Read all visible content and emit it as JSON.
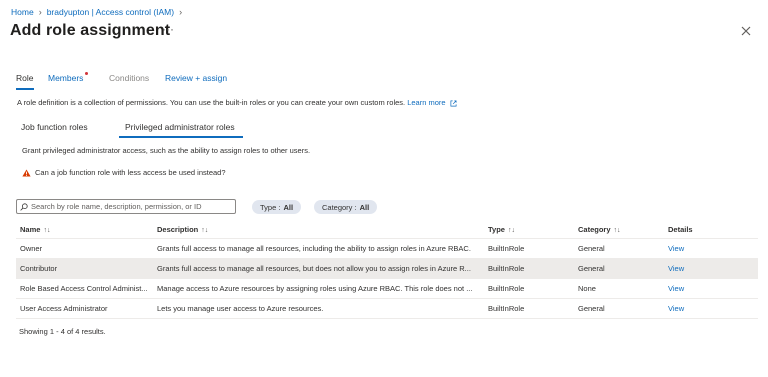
{
  "breadcrumb": {
    "home": "Home",
    "parent": "bradyupton | Access control (IAM)"
  },
  "page": {
    "title": "Add role assignment",
    "more": "···"
  },
  "tabs": [
    {
      "label": "Role"
    },
    {
      "label": "Members"
    },
    {
      "label": "Conditions"
    },
    {
      "label": "Review + assign"
    }
  ],
  "description": {
    "text": "A role definition is a collection of permissions. You can use the built-in roles or you can create your own custom roles.",
    "link": "Learn more"
  },
  "subtabs": [
    {
      "label": "Job function roles"
    },
    {
      "label": "Privileged administrator roles"
    }
  ],
  "grant_text": "Grant privileged administrator access, such as the ability to assign roles to other users.",
  "warning_text": "Can a job function role with less access be used instead?",
  "search": {
    "placeholder": "Search by role name, description, permission, or ID"
  },
  "filters": [
    {
      "label": "Type :",
      "value": "All"
    },
    {
      "label": "Category :",
      "value": "All"
    }
  ],
  "table": {
    "columns": [
      "Name",
      "Description",
      "Type",
      "Category",
      "Details"
    ],
    "rows": [
      {
        "name": "Owner",
        "description": "Grants full access to manage all resources, including the ability to assign roles in Azure RBAC.",
        "type": "BuiltInRole",
        "category": "General",
        "details": "View"
      },
      {
        "name": "Contributor",
        "description": "Grants full access to manage all resources, but does not allow you to assign roles in Azure R...",
        "type": "BuiltInRole",
        "category": "General",
        "details": "View"
      },
      {
        "name": "Role Based Access Control Administ...",
        "description": "Manage access to Azure resources by assigning roles using Azure RBAC. This role does not ...",
        "type": "BuiltInRole",
        "category": "None",
        "details": "View"
      },
      {
        "name": "User Access Administrator",
        "description": "Lets you manage user access to Azure resources.",
        "type": "BuiltInRole",
        "category": "General",
        "details": "View"
      }
    ]
  },
  "footer": {
    "showing": "Showing 1 - 4 of 4 results."
  },
  "colors": {
    "accent": "#0f6cbd",
    "required_dot": "#d13438",
    "warning": "#d83b01",
    "selected_row": "#edebe9",
    "pill": "#e1e6ef"
  },
  "icons": [
    "chevron-right-icon",
    "close-icon",
    "external-link-icon",
    "warning-icon",
    "search-icon",
    "sort-icon"
  ]
}
